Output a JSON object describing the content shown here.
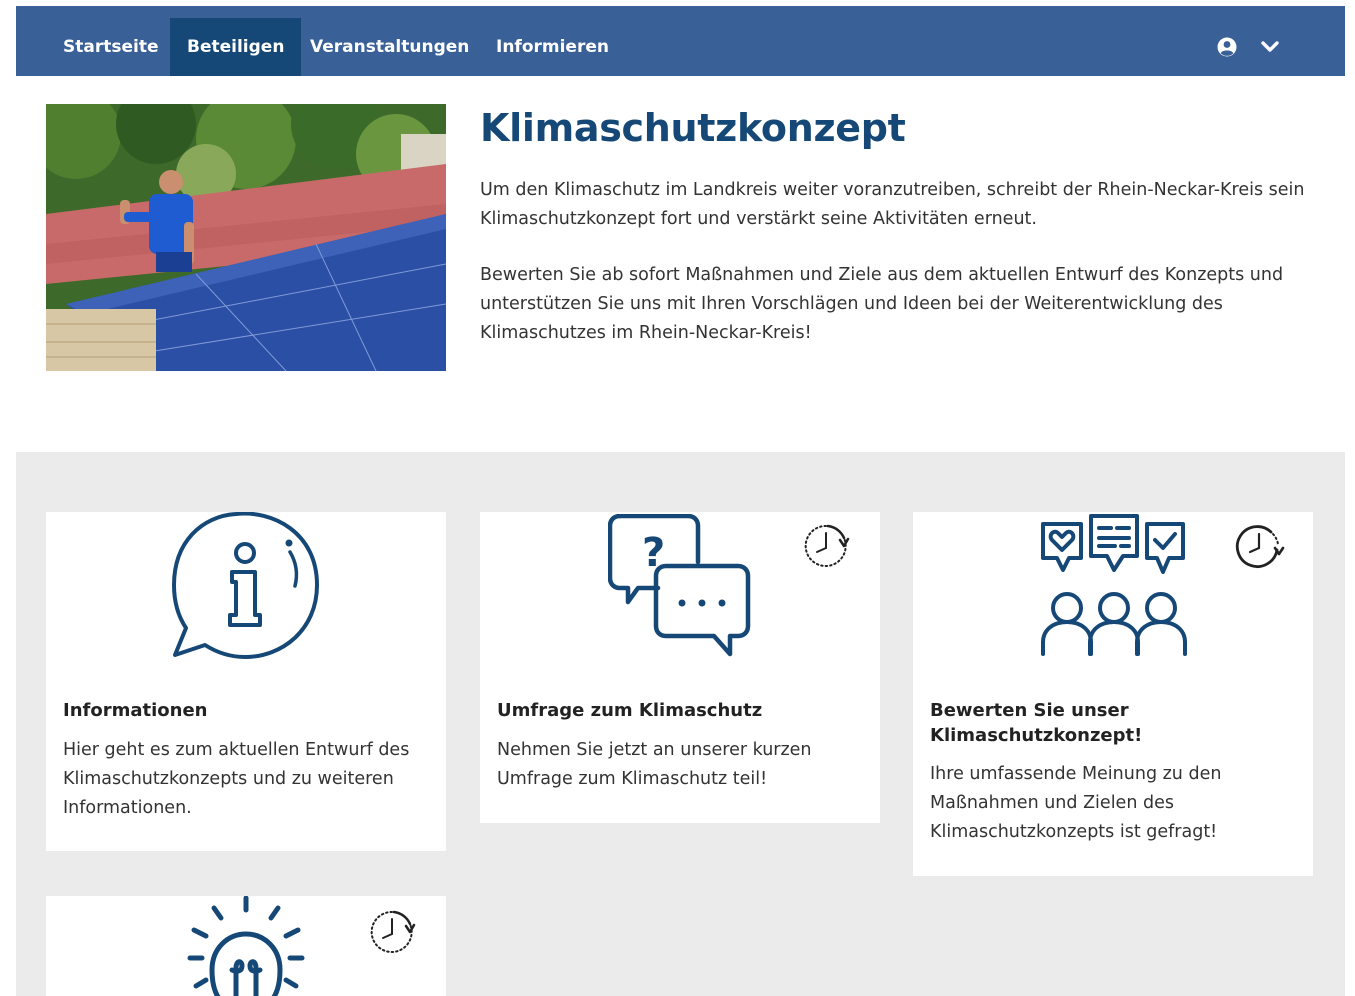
{
  "nav": {
    "items": [
      {
        "label": "Startseite",
        "active": false
      },
      {
        "label": "Beteiligen",
        "active": true
      },
      {
        "label": "Veranstaltungen",
        "active": false
      },
      {
        "label": "Informieren",
        "active": false
      }
    ],
    "user_icon": "user-circle-icon",
    "menu_icon": "chevron-down-icon"
  },
  "colors": {
    "nav_bg": "#3a6098",
    "nav_active": "#154876",
    "title": "#154876",
    "icon": "#154876",
    "section_bg": "#ebebeb"
  },
  "hero": {
    "image": "photo-man-solar-panels",
    "title": "Klimaschutzkonzept",
    "paragraph1": "Um den Klimaschutz im Landkreis weiter voranzutreiben, schreibt der Rhein-Neckar-Kreis sein Klimaschutzkonzept fort und verstärkt seine Aktivitäten erneut.",
    "paragraph2": "Bewerten Sie ab sofort Maßnahmen und Ziele aus dem aktuellen Entwurf des Konzepts und unterstützen Sie uns mit Ihren Vorschlägen und Ideen bei der Weiterentwicklung des Klimaschutzes im Rhein-Neckar-Kreis!"
  },
  "cards": [
    {
      "icon": "info-speech-bubble-icon",
      "title": "Informationen",
      "text": "Hier geht es zum aktuellen Entwurf des Klimaschutzkonzepts und zu weiteren Informationen.",
      "status_icon": null
    },
    {
      "icon": "question-chat-bubbles-icon",
      "title": "Umfrage zum Klimaschutz",
      "text": "Nehmen Sie jetzt an unserer kurzen Umfrage zum Klimaschutz teil!",
      "status_icon": "clock-upcoming-icon"
    },
    {
      "icon": "group-feedback-icon",
      "title": "Bewerten Sie unser Klimaschutzkonzept!",
      "text": "Ihre umfassende Meinung zu den Maßnahmen und Zielen des Klimaschutzkonzepts ist gefragt!",
      "status_icon": "clock-running-icon"
    },
    {
      "icon": "lightbulb-idea-icon",
      "title": "",
      "text": "",
      "status_icon": "clock-upcoming-icon"
    }
  ]
}
